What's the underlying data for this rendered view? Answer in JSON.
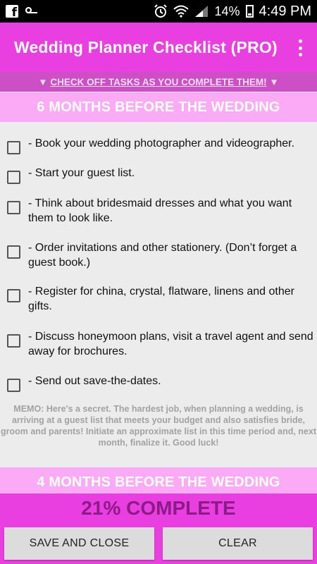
{
  "status_bar": {
    "battery": "14%",
    "time": "4:49 PM"
  },
  "app_bar": {
    "title": "Wedding Planner Checklist (PRO)"
  },
  "instruction": {
    "prefix": "▼ ",
    "text": "CHECK OFF TASKS AS YOU COMPLETE THEM!",
    "suffix": " ▼"
  },
  "sections": [
    {
      "title": "6 MONTHS BEFORE THE WEDDING"
    },
    {
      "title": "4 MONTHS BEFORE THE WEDDING"
    }
  ],
  "tasks": [
    {
      "text": "- Book your wedding photographer and videographer.",
      "checked": false
    },
    {
      "text": "- Start your guest list.",
      "checked": false
    },
    {
      "text": "- Think about bridesmaid dresses and what you want them to look like.",
      "checked": false
    },
    {
      "text": "- Order invitations and other stationery. (Don’t forget a guest book.)",
      "checked": false
    },
    {
      "text": "- Register for china, crystal, flatware, linens and other gifts.",
      "checked": false
    },
    {
      "text": "- Discuss honeymoon plans, visit a travel agent and send away for brochures.",
      "checked": false
    },
    {
      "text": "- Send out save-the-dates.",
      "checked": false
    }
  ],
  "memo": "MEMO: Here's a secret. The hardest job, when planning a wedding, is arriving at a guest list that meets your budget and also satisfies bride, groom and parents! Initiate an approximate list in this time period and, next month, finalize it. Good luck!",
  "progress": {
    "label": "21% COMPLETE",
    "percent": 21
  },
  "buttons": {
    "save_close": "SAVE AND CLOSE",
    "clear": "CLEAR"
  },
  "colors": {
    "accent": "#ea3fe0",
    "section_header": "#fbaaf5",
    "instruction_bar": "#cc4fc6",
    "progress_text": "#8b1c86"
  }
}
